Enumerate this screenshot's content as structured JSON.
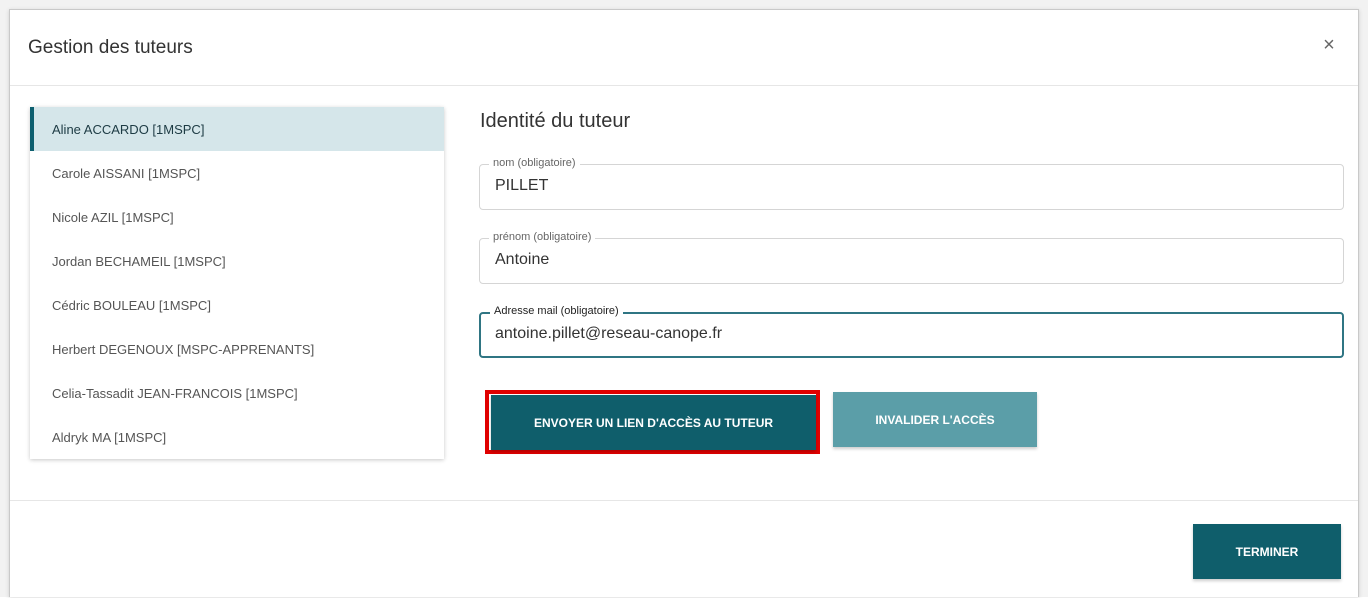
{
  "backdrop": {
    "corner_text": "..."
  },
  "dialog": {
    "title": "Gestion des tuteurs",
    "close_icon": "close-icon",
    "close_symbol": "×"
  },
  "tutors": [
    {
      "label": "Aline ACCARDO [1MSPC]",
      "selected": true
    },
    {
      "label": "Carole AISSANI [1MSPC]",
      "selected": false
    },
    {
      "label": "Nicole AZIL [1MSPC]",
      "selected": false
    },
    {
      "label": "Jordan BECHAMEIL [1MSPC]",
      "selected": false
    },
    {
      "label": "Cédric BOULEAU [1MSPC]",
      "selected": false
    },
    {
      "label": "Herbert DEGENOUX [MSPC-APPRENANTS]",
      "selected": false
    },
    {
      "label": "Celia-Tassadit JEAN-FRANCOIS [1MSPC]",
      "selected": false
    },
    {
      "label": "Aldryk MA [1MSPC]",
      "selected": false
    }
  ],
  "identity": {
    "title": "Identité du tuteur",
    "nom": {
      "label": "nom (obligatoire)",
      "value": "PILLET"
    },
    "prenom": {
      "label": "prénom (obligatoire)",
      "value": "Antoine"
    },
    "email": {
      "label": "Adresse mail (obligatoire)",
      "value": "antoine.pillet@reseau-canope.fr",
      "focused": true
    }
  },
  "actions": {
    "send_link_label": "ENVOYER UN LIEN D'ACCÈS AU TUTEUR",
    "invalidate_label": "INVALIDER L'ACCÈS",
    "finish_label": "TERMINER"
  },
  "colors": {
    "primary": "#0f5e6b",
    "muted": "#5b9ea8",
    "selected_bg": "#d5e6ea",
    "highlight": "#e00000"
  }
}
